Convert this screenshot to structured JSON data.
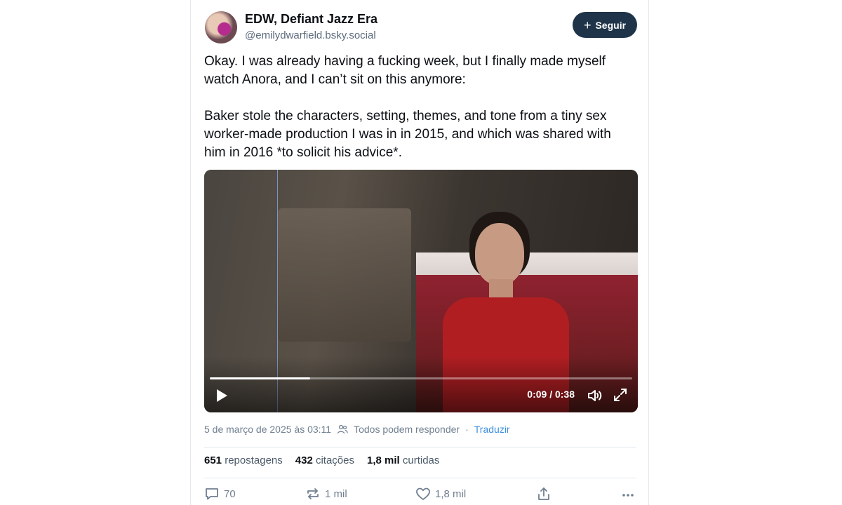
{
  "author": {
    "display_name": "EDW, Defiant Jazz Era",
    "handle": "@emilydwarfield.bsky.social"
  },
  "follow": {
    "label": "Seguir",
    "icon": "plus-icon"
  },
  "post": {
    "paragraphs": [
      "Okay. I was already having a fucking week, but I finally made myself watch Anora, and I can’t sit on this anymore:",
      "Baker stole the characters, setting, themes, and tone from a tiny sex worker-made production I was in in 2015, and which was shared with him in 2016 *to solicit his advice*."
    ]
  },
  "video": {
    "time": "0:09 / 0:38",
    "progress_fraction": 0.237,
    "icons": [
      "play-icon",
      "volume-icon",
      "fullscreen-icon"
    ]
  },
  "meta": {
    "date": "5 de março de 2025 às 03:11",
    "reply_setting": "Todos podem responder",
    "separator": "·",
    "translate": "Traduzir"
  },
  "stats": {
    "reposts_count": "651",
    "reposts_label": "repostagens",
    "quotes_count": "432",
    "quotes_label": "citações",
    "likes_count": "1,8 mil",
    "likes_label": "curtidas"
  },
  "actions": {
    "reply_count": "70",
    "repost_count": "1 mil",
    "like_count": "1,8 mil"
  },
  "colors": {
    "follow_bg": "#1f3448",
    "link": "#3b8ee0",
    "muted": "#6f7f90"
  }
}
